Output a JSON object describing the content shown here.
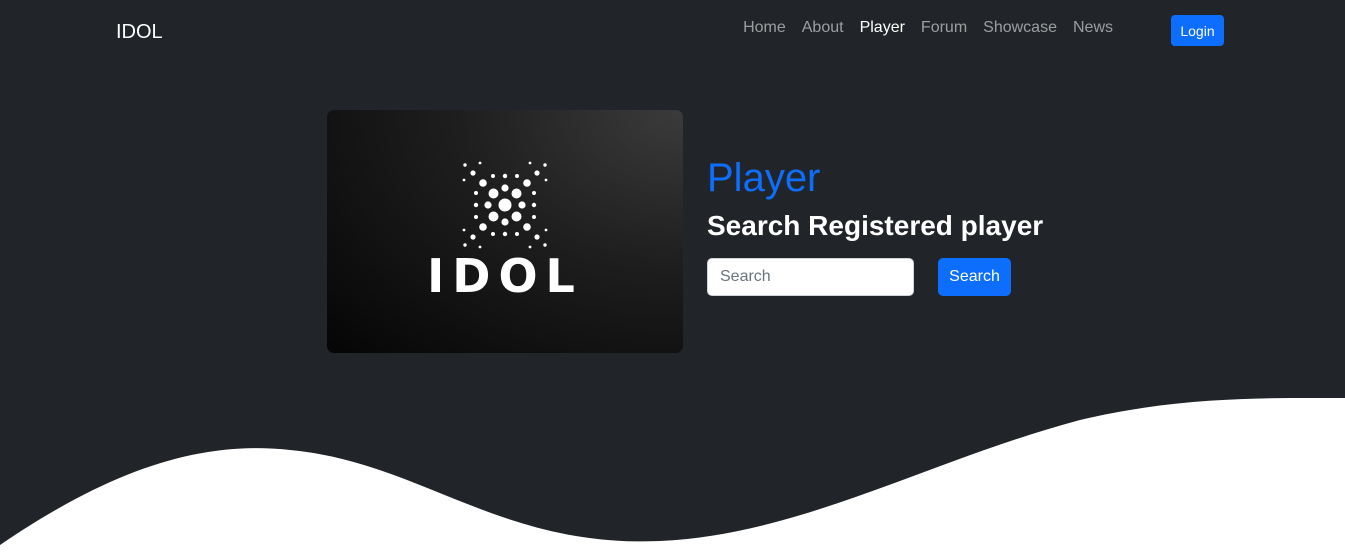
{
  "navbar": {
    "brand": "IDOL",
    "links": [
      {
        "label": "Home"
      },
      {
        "label": "About"
      },
      {
        "label": "Player"
      },
      {
        "label": "Forum"
      },
      {
        "label": "Showcase"
      },
      {
        "label": "News"
      }
    ],
    "active_link": "Player",
    "login_label": "Login"
  },
  "hero": {
    "logo_text": "IDOL",
    "title": "Player",
    "subtitle": "Search Registered player",
    "search": {
      "placeholder": "Search",
      "value": "",
      "button_label": "Search"
    }
  },
  "colors": {
    "background": "#212529",
    "accent": "#0d6efd",
    "wave": "#ffffff"
  },
  "icons": {
    "logo": "dot-x-logo-icon"
  }
}
